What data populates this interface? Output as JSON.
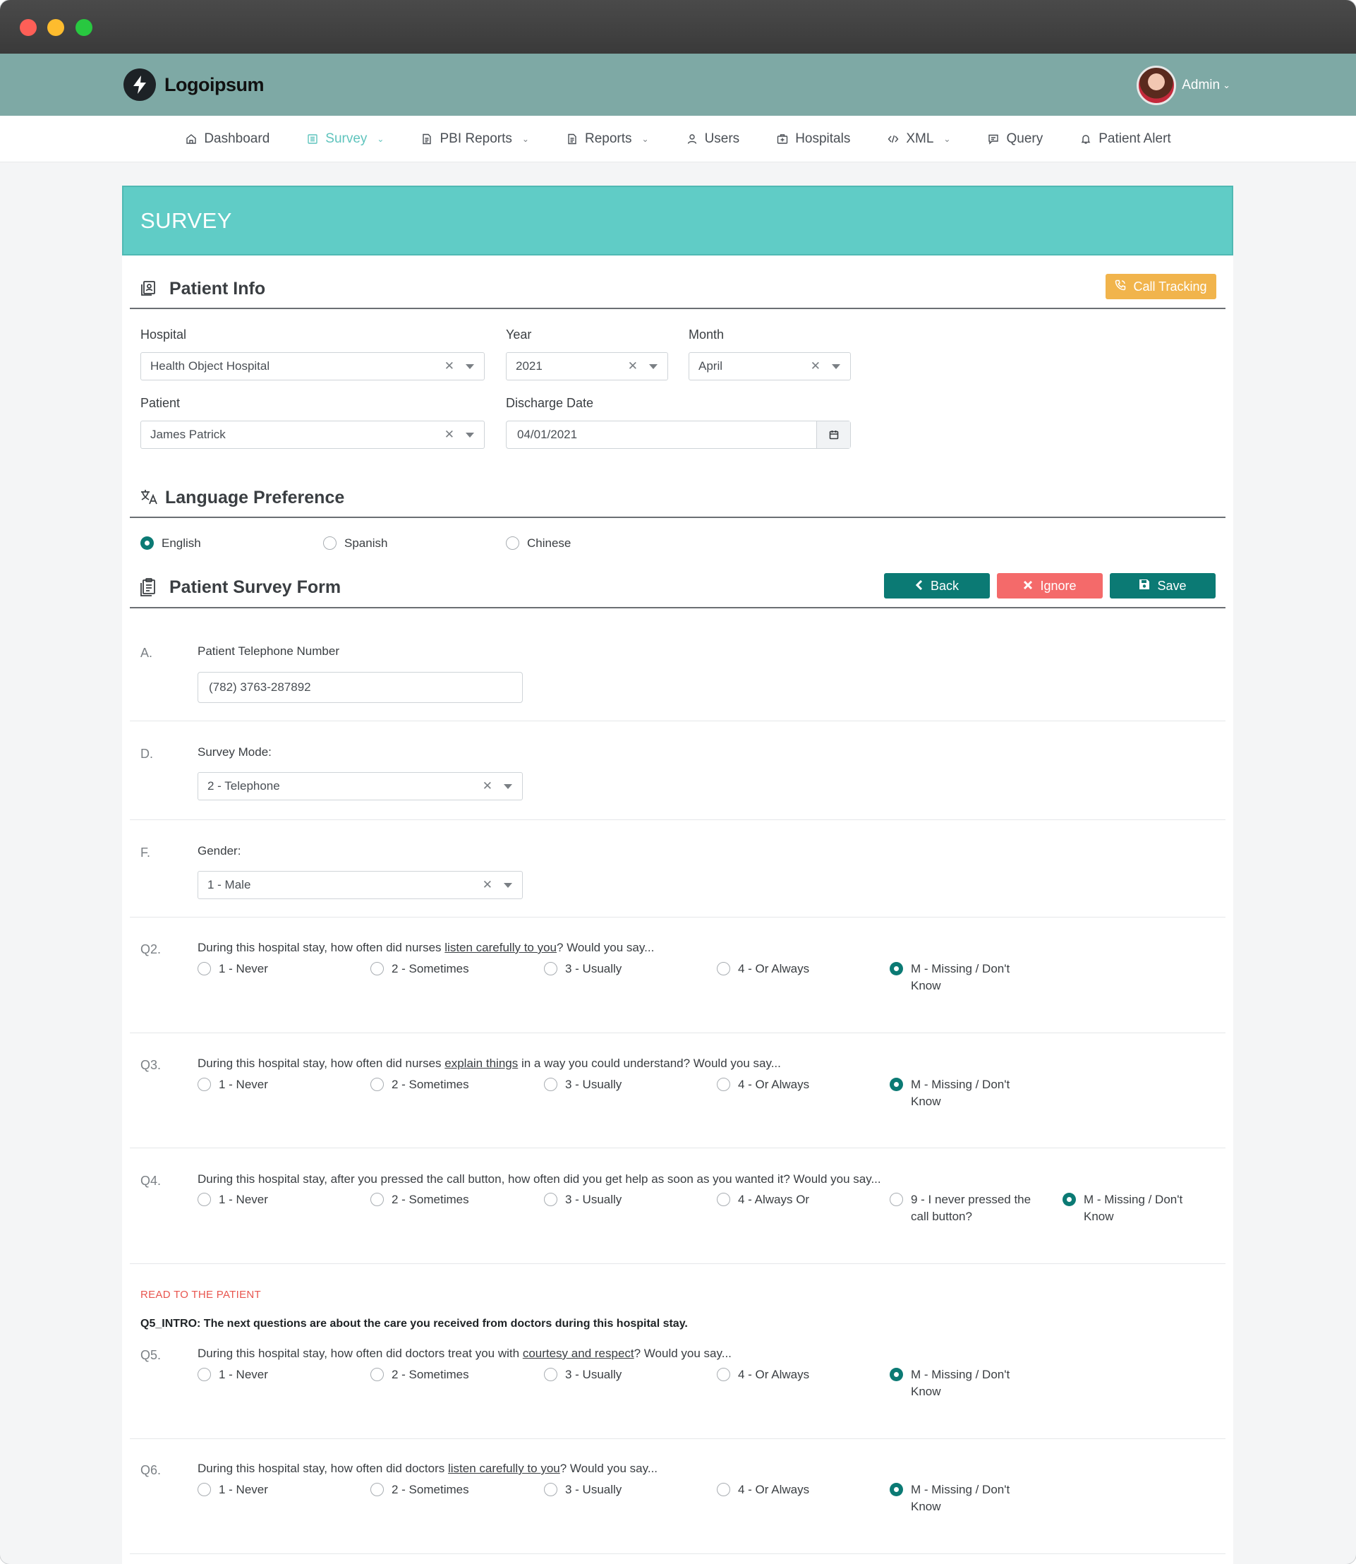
{
  "brand": {
    "name": "Logoipsum"
  },
  "user": {
    "name": "Admin"
  },
  "nav": [
    {
      "label": "Dashboard",
      "icon": "home-icon",
      "active": false,
      "dropdown": false
    },
    {
      "label": "Survey",
      "icon": "list-icon",
      "active": true,
      "dropdown": true
    },
    {
      "label": "PBI Reports",
      "icon": "file-icon",
      "active": false,
      "dropdown": true
    },
    {
      "label": "Reports",
      "icon": "file-icon",
      "active": false,
      "dropdown": true
    },
    {
      "label": "Users",
      "icon": "user-icon",
      "active": false,
      "dropdown": false
    },
    {
      "label": "Hospitals",
      "icon": "hospital-icon",
      "active": false,
      "dropdown": false
    },
    {
      "label": "XML",
      "icon": "code-icon",
      "active": false,
      "dropdown": true
    },
    {
      "label": "Query",
      "icon": "message-icon",
      "active": false,
      "dropdown": false
    },
    {
      "label": "Patient Alert",
      "icon": "bell-icon",
      "active": false,
      "dropdown": false
    }
  ],
  "page_title": "SURVEY",
  "patient_info": {
    "title": "Patient Info",
    "call_tracking_label": "Call Tracking",
    "hospital_label": "Hospital",
    "hospital_value": "Health Object Hospital",
    "year_label": "Year",
    "year_value": "2021",
    "month_label": "Month",
    "month_value": "April",
    "patient_label": "Patient",
    "patient_value": "James Patrick",
    "discharge_label": "Discharge Date",
    "discharge_value": "04/01/2021"
  },
  "language": {
    "title": "Language Preference",
    "options": [
      "English",
      "Spanish",
      "Chinese"
    ],
    "selected": "English"
  },
  "survey_form": {
    "title": "Patient Survey Form",
    "back_label": "Back",
    "ignore_label": "Ignore",
    "save_label": "Save",
    "phone": {
      "code": "A.",
      "label": "Patient Telephone Number",
      "value": "(782) 3763-287892"
    },
    "mode": {
      "code": "D.",
      "label": "Survey Mode:",
      "value": "2 - Telephone"
    },
    "gender": {
      "code": "F.",
      "label": "Gender:",
      "value": "1 - Male"
    },
    "q2": {
      "code": "Q2.",
      "pre": "During this hospital stay, how often did nurses ",
      "link": "listen carefully to you",
      "post": "? Would you say...",
      "options": [
        "1 - Never",
        "2 - Sometimes",
        "3 - Usually",
        "4 - Or Always",
        "M - Missing / Don't Know"
      ],
      "selected": "M - Missing / Don't Know"
    },
    "q3": {
      "code": "Q3.",
      "pre": "During this hospital stay, how often did nurses ",
      "link": "explain things",
      "post": " in a way you could understand? Would you say...",
      "options": [
        "1 - Never",
        "2 - Sometimes",
        "3 - Usually",
        "4 - Or Always",
        "M - Missing / Don't Know"
      ],
      "selected": "M - Missing / Don't Know"
    },
    "q4": {
      "code": "Q4.",
      "text": "During this hospital stay, after you pressed the call button, how often did you get help as soon as you wanted it? Would you say...",
      "options": [
        "1 - Never",
        "2 - Sometimes",
        "3 - Usually",
        "4 - Always Or",
        "9 - I never pressed the call button?",
        "M - Missing / Don't Know"
      ],
      "selected": "M - Missing / Don't Know"
    },
    "read_label": "READ TO THE PATIENT",
    "q5_intro": "Q5_INTRO: The next questions are about the care you received from doctors during this hospital stay.",
    "q5": {
      "code": "Q5.",
      "pre": "During this hospital stay, how often did doctors treat you with ",
      "link": "courtesy and respect",
      "post": "? Would you say...",
      "options": [
        "1 - Never",
        "2 - Sometimes",
        "3 - Usually",
        "4 - Or Always",
        "M - Missing / Don't Know"
      ],
      "selected": "M - Missing / Don't Know"
    },
    "q6": {
      "code": "Q6.",
      "pre": "During this hospital stay, how often did doctors ",
      "link": "listen carefully to you",
      "post": "? Would you say...",
      "options": [
        "1 - Never",
        "2 - Sometimes",
        "3 - Usually",
        "4 - Or Always",
        "M - Missing / Don't Know"
      ],
      "selected": "M - Missing / Don't Know"
    }
  }
}
